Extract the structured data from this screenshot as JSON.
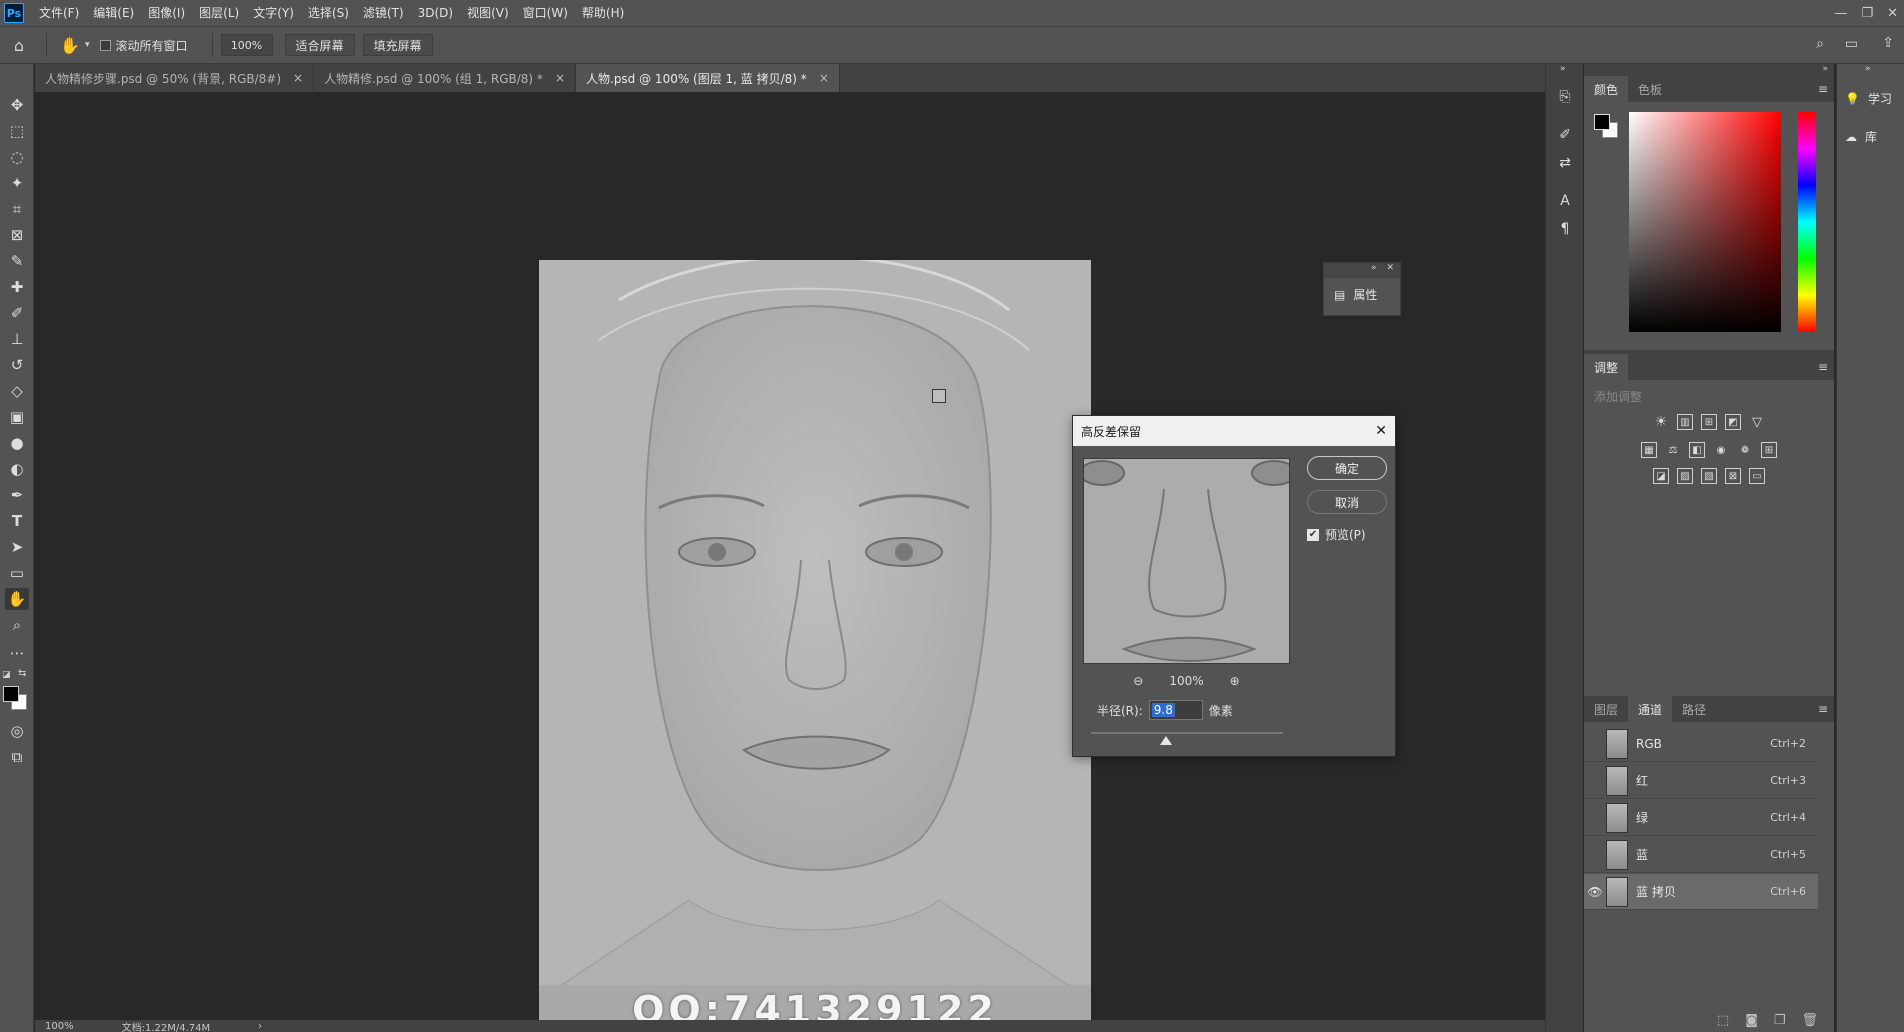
{
  "app": {
    "logo": "Ps"
  },
  "menubar": {
    "items": [
      "文件(F)",
      "编辑(E)",
      "图像(I)",
      "图层(L)",
      "文字(Y)",
      "选择(S)",
      "滤镜(T)",
      "3D(D)",
      "视图(V)",
      "窗口(W)",
      "帮助(H)"
    ],
    "window_controls": [
      "—",
      "❐",
      "✕"
    ]
  },
  "options": {
    "scroll_all_label": "滚动所有窗口",
    "zoom": "100%",
    "fit_screen": "适合屏幕",
    "fill_screen": "填充屏幕"
  },
  "tabs": [
    {
      "label": "人物精修步骤.psd @ 50% (背景, RGB/8#)",
      "close": "×"
    },
    {
      "label": "人物精修.psd @ 100% (组 1, RGB/8) *",
      "close": "×"
    },
    {
      "label": "人物.psd @ 100% (图层 1, 蓝 拷贝/8) *",
      "close": "×"
    }
  ],
  "canvas": {
    "watermark": "QQ:741329122"
  },
  "properties_mini": {
    "label": "属性"
  },
  "dialog": {
    "title": "高反差保留",
    "ok": "确定",
    "cancel": "取消",
    "preview_label": "预览(P)",
    "zoom": "100%",
    "radius_label": "半径(R):",
    "radius_value": "9.8",
    "unit": "像素",
    "slider_position": 0.39
  },
  "color_panel": {
    "tabs": [
      "颜色",
      "色板"
    ]
  },
  "adjust_panel": {
    "tab": "调整",
    "hint": "添加调整"
  },
  "channels_panel": {
    "tabs": [
      "图层",
      "通道",
      "路径"
    ],
    "rows": [
      {
        "name": "RGB",
        "shortcut": "Ctrl+2",
        "visible": false
      },
      {
        "name": "红",
        "shortcut": "Ctrl+3",
        "visible": false
      },
      {
        "name": "绿",
        "shortcut": "Ctrl+4",
        "visible": false
      },
      {
        "name": "蓝",
        "shortcut": "Ctrl+5",
        "visible": false
      },
      {
        "name": "蓝 拷贝",
        "shortcut": "Ctrl+6",
        "visible": true
      }
    ]
  },
  "right_col": {
    "learn": "学习",
    "library": "库"
  },
  "status": {
    "zoom": "100%",
    "doc": "文档:1.22M/4.74M"
  }
}
